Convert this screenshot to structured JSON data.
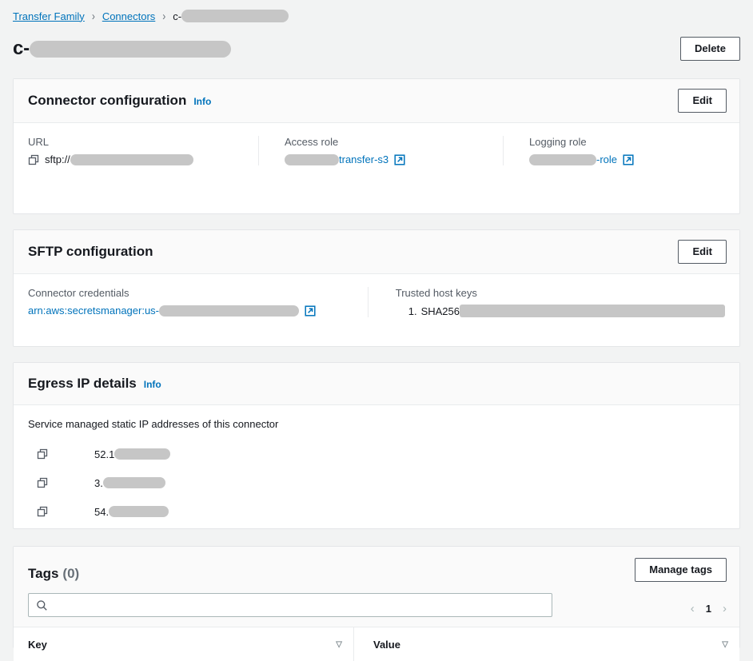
{
  "breadcrumb": {
    "items": [
      {
        "label": "Transfer Family",
        "type": "link"
      },
      {
        "label": "Connectors",
        "type": "link"
      },
      {
        "label": "c-",
        "type": "current",
        "redacted": true
      }
    ],
    "separator": "›"
  },
  "header": {
    "title_prefix": "c-",
    "title_redacted": true,
    "delete_label": "Delete"
  },
  "connector_configuration": {
    "title": "Connector configuration",
    "info_label": "Info",
    "edit_label": "Edit",
    "fields": {
      "url": {
        "label": "URL",
        "value_prefix": "sftp://",
        "redacted": true,
        "copy_icon": "copy-icon"
      },
      "access_role": {
        "label": "Access role",
        "value_suffix": "transfer-s3",
        "redacted": true,
        "external_icon": "external-link-icon"
      },
      "logging_role": {
        "label": "Logging role",
        "value_suffix": "-role",
        "redacted": true,
        "external_icon": "external-link-icon"
      }
    }
  },
  "sftp_configuration": {
    "title": "SFTP configuration",
    "edit_label": "Edit",
    "fields": {
      "connector_credentials": {
        "label": "Connector credentials",
        "value_prefix": "arn:aws:secretsmanager:us-",
        "redacted": true,
        "external_icon": "external-link-icon"
      },
      "trusted_host_keys": {
        "label": "Trusted host keys",
        "items": [
          {
            "index": "1.",
            "algorithm": "SHA256",
            "redacted": true
          }
        ]
      }
    }
  },
  "egress_ip_details": {
    "title": "Egress IP details",
    "info_label": "Info",
    "description": "Service managed static IP addresses of this connector",
    "addresses": [
      {
        "value_prefix": "52.1",
        "redacted": true,
        "copy_icon": "copy-icon"
      },
      {
        "value_prefix": "3.",
        "redacted": true,
        "copy_icon": "copy-icon"
      },
      {
        "value_prefix": "54.",
        "redacted": true,
        "copy_icon": "copy-icon"
      }
    ]
  },
  "tags": {
    "title": "Tags",
    "count": "(0)",
    "manage_label": "Manage tags",
    "search_value": "",
    "search_placeholder": "",
    "search_icon": "search-icon",
    "pagination": {
      "prev_icon": "chevron-left-icon",
      "current_page": "1",
      "next_icon": "chevron-right-icon"
    },
    "columns": [
      {
        "label": "Key",
        "sort_icon": "sort-caret-icon"
      },
      {
        "label": "Value",
        "sort_icon": "sort-caret-icon"
      }
    ]
  },
  "colors": {
    "link": "#0073bb",
    "page_background": "#f2f3f3",
    "card_background": "#ffffff",
    "redaction": "#c6c6c6",
    "label_text": "#545b64"
  }
}
